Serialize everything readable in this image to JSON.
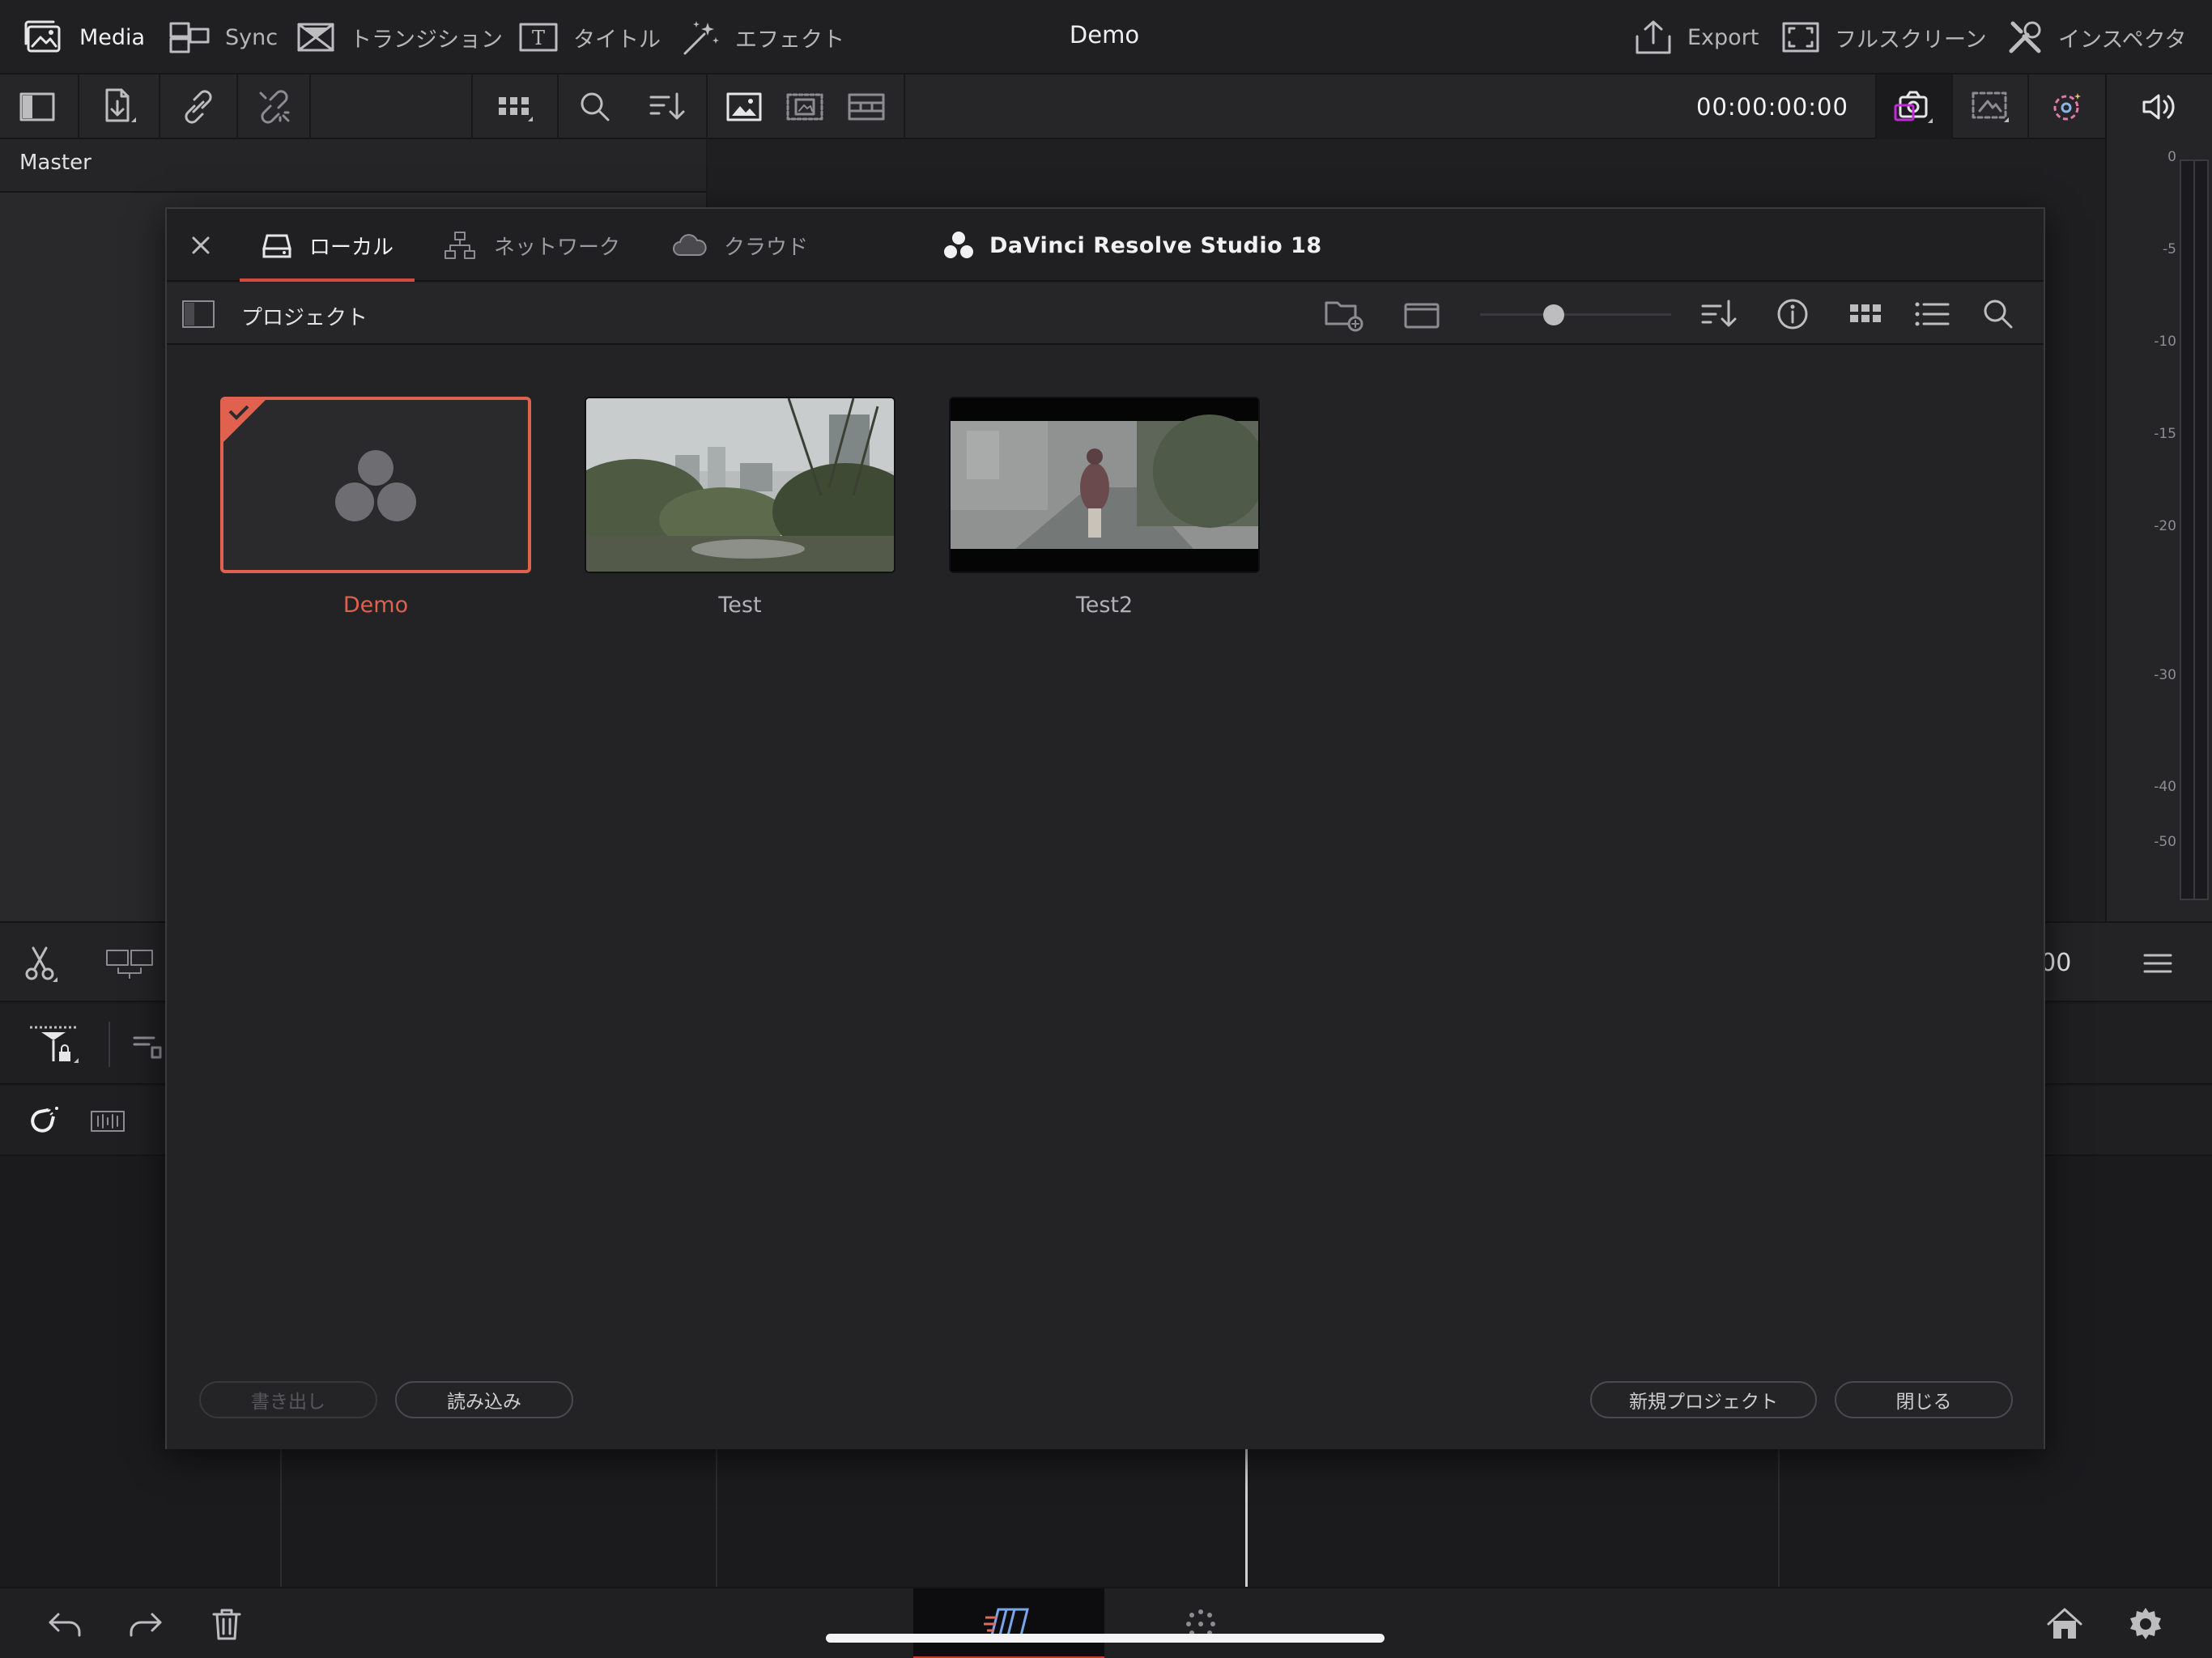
{
  "app": {
    "title": "Demo",
    "menu": [
      {
        "label": "Media",
        "icon": "media-pool-icon",
        "active": true
      },
      {
        "label": "Sync",
        "icon": "sync-bin-icon",
        "active": false
      },
      {
        "label": "トランジション",
        "icon": "transition-icon",
        "active": false
      },
      {
        "label": "タイトル",
        "icon": "title-icon",
        "active": false
      },
      {
        "label": "エフェクト",
        "icon": "effects-icon",
        "active": false
      }
    ],
    "menu_right": [
      {
        "label": "Export",
        "icon": "export-icon"
      },
      {
        "label": "フルスクリーン",
        "icon": "fullscreen-icon"
      },
      {
        "label": "インスペクタ",
        "icon": "inspector-icon"
      }
    ]
  },
  "toolbar": {
    "timecode": "00:00:00:00"
  },
  "bin": {
    "label": "Master"
  },
  "audio_meter": {
    "ticks": [
      "0",
      "-5",
      "-10",
      "-15",
      "-20",
      "-30",
      "-40",
      "-50"
    ]
  },
  "timeline": {
    "timecode_fragment": ":00"
  },
  "dialog": {
    "tabs": [
      {
        "label": "ローカル",
        "icon": "drive-icon",
        "active": true
      },
      {
        "label": "ネットワーク",
        "icon": "network-icon",
        "active": false
      },
      {
        "label": "クラウド",
        "icon": "cloud-icon",
        "active": false
      }
    ],
    "brand": "DaVinci Resolve Studio 18",
    "section_title": "プロジェクト",
    "projects": [
      {
        "name": "Demo",
        "selected": true,
        "thumb": "resolve-logo"
      },
      {
        "name": "Test",
        "selected": false,
        "thumb": "park-photo"
      },
      {
        "name": "Test2",
        "selected": false,
        "thumb": "street-photo"
      }
    ],
    "buttons": {
      "export": "書き出し",
      "import": "読み込み",
      "new_project": "新規プロジェクト",
      "close": "閉じる"
    }
  },
  "colors": {
    "accent": "#e0614e",
    "background": "#1b1b1e",
    "dialog": "#232326"
  }
}
